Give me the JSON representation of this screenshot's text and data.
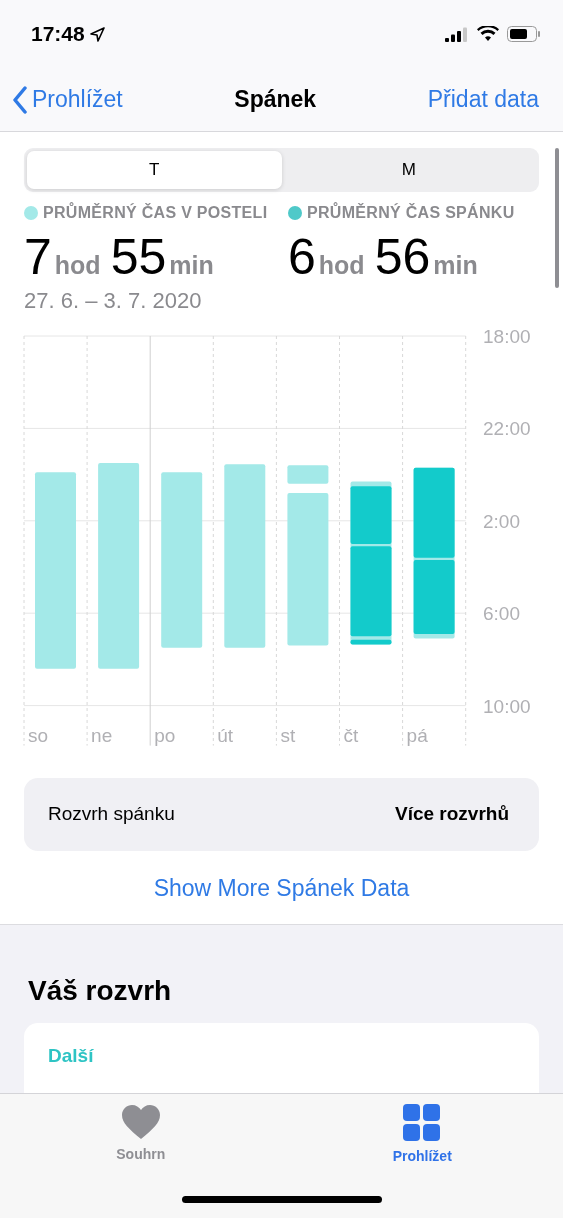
{
  "status_bar": {
    "time": "17:48"
  },
  "nav": {
    "back": "Prohlížet",
    "title": "Spánek",
    "action": "Přidat data"
  },
  "segments": [
    {
      "label": "T",
      "selected": true
    },
    {
      "label": "M",
      "selected": false
    }
  ],
  "stats": [
    {
      "label": "PRŮMĚRNÝ ČAS V POSTELI",
      "color": "#a3e9e8",
      "hours": "7",
      "hours_unit": "hod",
      "minutes": "55",
      "minutes_unit": "min"
    },
    {
      "label": "PRŮMĚRNÝ ČAS SPÁNKU",
      "color": "#4fc9c9",
      "hours": "6",
      "hours_unit": "hod",
      "minutes": "56",
      "minutes_unit": "min"
    }
  ],
  "date_range": "27. 6. – 3. 7. 2020",
  "chart": {
    "days": [
      "so",
      "ne",
      "po",
      "út",
      "st",
      "čt",
      "pá"
    ],
    "hour_labels": [
      "18:00",
      "22:00",
      "2:00",
      "6:00",
      "10:00"
    ]
  },
  "schedule_row": {
    "label": "Rozvrh spánku",
    "value": "Více rozvrhů"
  },
  "more_link": "Show More Spánek Data",
  "schedule_section": {
    "title": "Váš rozvrh",
    "card_label": "Další"
  },
  "tab_bar": [
    {
      "label": "Souhrn",
      "selected": false
    },
    {
      "label": "Prohlížet",
      "selected": true
    }
  ]
}
